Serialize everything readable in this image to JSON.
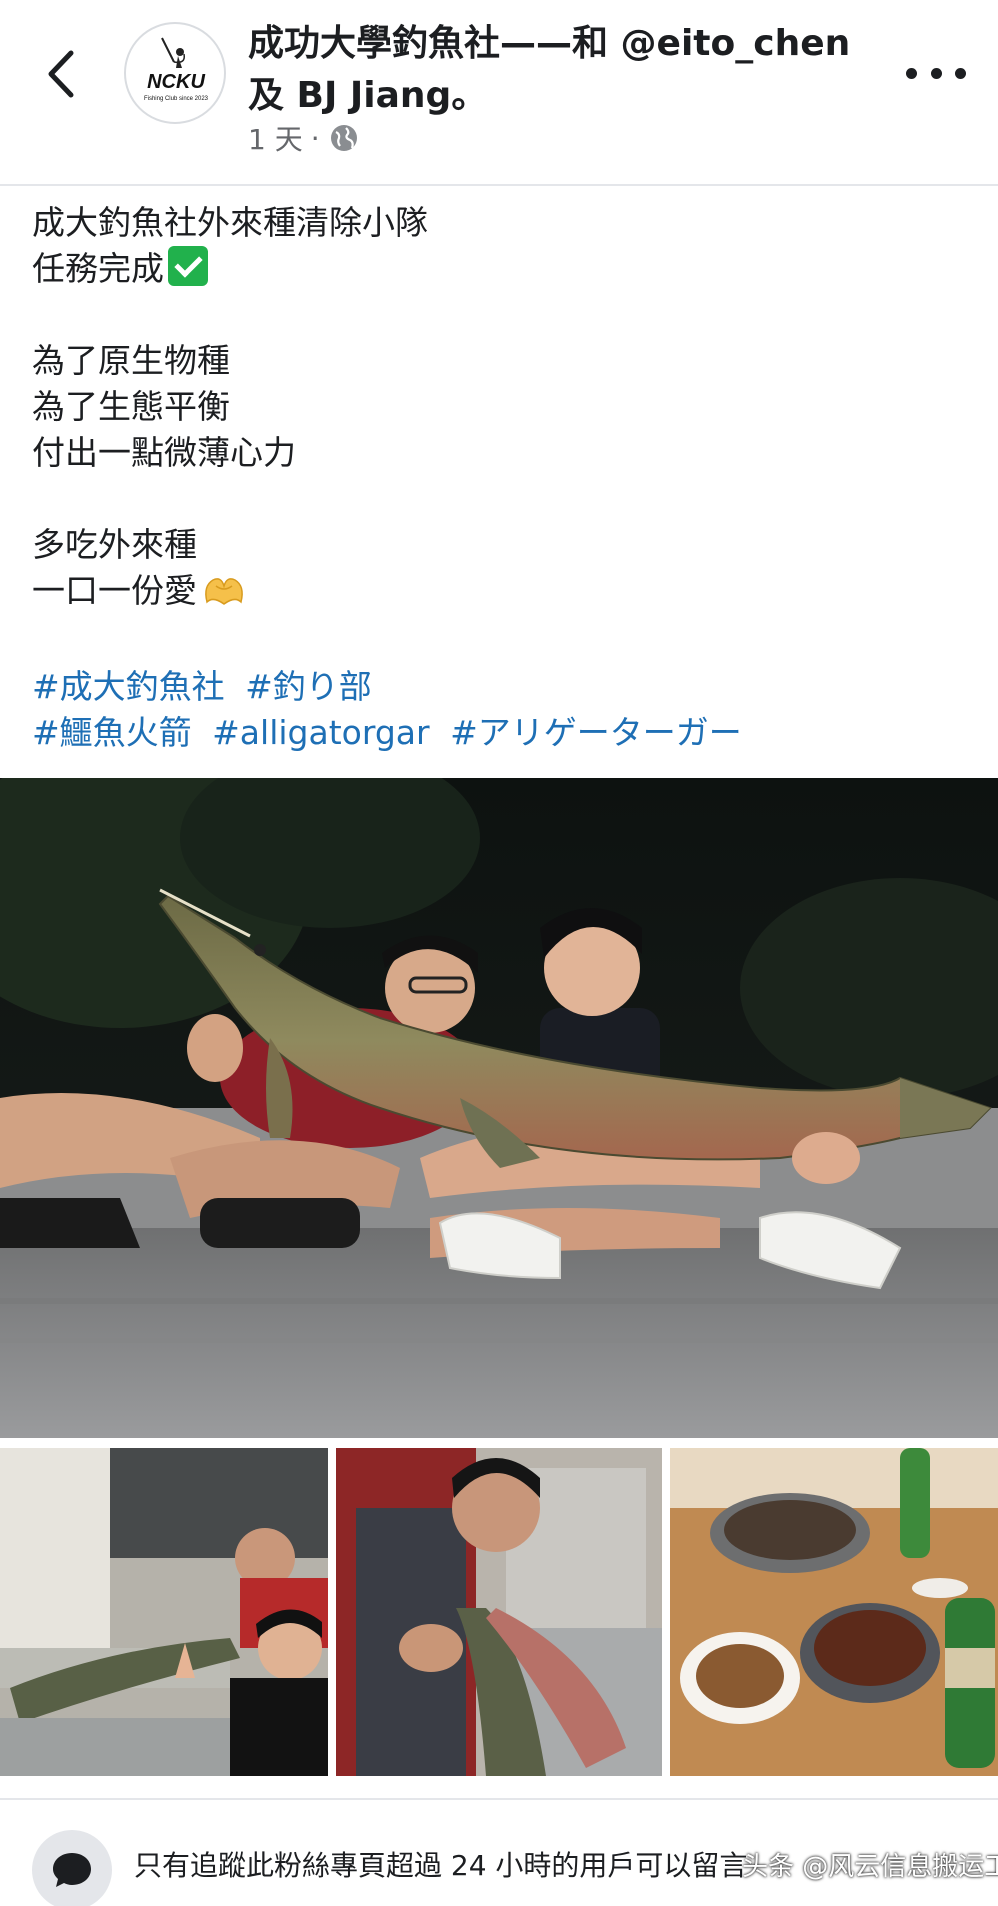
{
  "header": {
    "back_icon": "chevron-left-icon",
    "avatar_text": "NCKU",
    "avatar_subtext": "Fishing Club since 2023",
    "title": "成功大學釣魚社——和 @eito_chen 及 BJ Jiang。",
    "time": "1 天",
    "separator": "·",
    "privacy_icon": "globe-icon",
    "more_icon": "more-dots-icon"
  },
  "caption": {
    "line1": "成大釣魚社外來種清除小隊",
    "line2": "任務完成",
    "line3": "為了原生物種",
    "line4": "為了生態平衡",
    "line5": "付出一點微薄心力",
    "line6": "多吃外來種",
    "line7": "一口一份愛"
  },
  "hashtags": {
    "row1": [
      "#成大釣魚社",
      "#釣り部"
    ],
    "row2": [
      "#鱷魚火箭",
      "#alligatorgar",
      "#アリゲーターガー"
    ]
  },
  "photos": {
    "main": "two-people-holding-alligator-gar-photo",
    "thumb1": "fish-on-counter-photo",
    "thumb2": "cleaning-fish-photo",
    "thumb3": "dinner-table-photo"
  },
  "footer": {
    "comment_icon": "comment-bubble-icon",
    "notice": "只有追蹤此粉絲專頁超過 24 小時的用戶可以留言",
    "watermark": "头条 @风云信息搬运工"
  },
  "colors": {
    "hashtag": "#1e6fb5",
    "text": "#1c1e21",
    "secondary": "#65676b",
    "divider": "#e4e6ea"
  }
}
